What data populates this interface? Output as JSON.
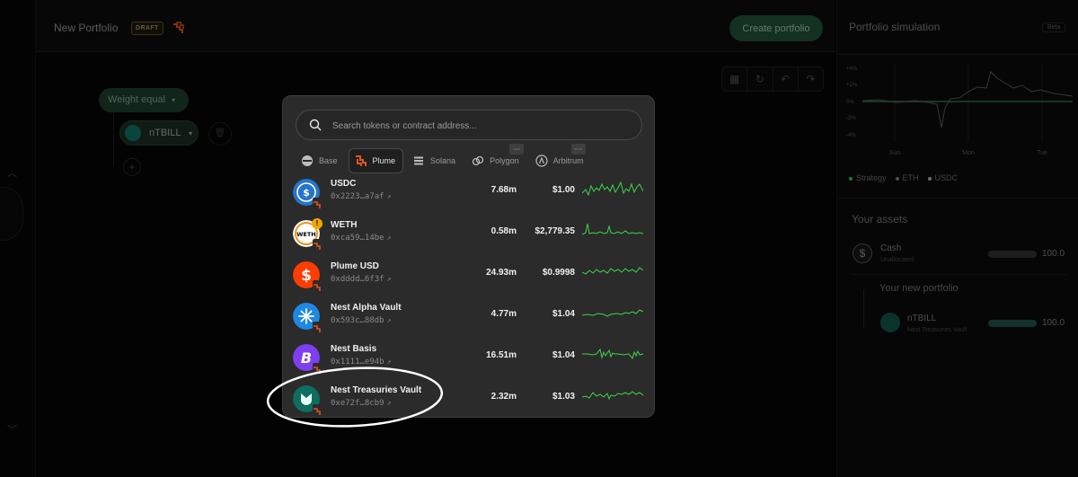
{
  "header": {
    "title": "New Portfolio",
    "draft_badge": "DRAFT",
    "create_label": "Create portfolio"
  },
  "canvas": {
    "weight_label": "Weight equal",
    "node_token": "nTBILL"
  },
  "simulation": {
    "title": "Portfolio simulation",
    "beta": "Beta",
    "y_ticks": [
      "+4%",
      "+2%",
      "0%",
      "-2%",
      "-4%"
    ],
    "x_ticks": [
      "Sun",
      "Mon",
      "Tue"
    ],
    "legend": [
      {
        "label": "Strategy",
        "color": "#3fb950"
      },
      {
        "label": "ETH",
        "color": "#777777"
      },
      {
        "label": "USDC",
        "color": "#aaaaaa"
      }
    ]
  },
  "assets": {
    "title": "Your assets",
    "cash_name": "Cash",
    "cash_sub": "Unallocated",
    "cash_pct": "100.0",
    "new_portfolio": "Your new portfolio",
    "token_name": "nTBILL",
    "token_sub": "Nest Treasuries Vault",
    "token_pct": "100.0"
  },
  "modal": {
    "search_placeholder": "Search tokens or contract address...",
    "chains": [
      {
        "label": "Base",
        "active": false
      },
      {
        "label": "Plume",
        "active": true
      },
      {
        "label": "Solana",
        "active": false
      },
      {
        "label": "Polygon",
        "active": false
      },
      {
        "label": "Arbitrum",
        "active": false
      }
    ],
    "badges": [
      "soon",
      "soon"
    ],
    "tokens": [
      {
        "name": "USDC",
        "address": "0x2223…a7af",
        "volume": "7.68m",
        "price": "$1.00",
        "icon_color": "#2775ca"
      },
      {
        "name": "WETH",
        "address": "0xca59…14be",
        "volume": "0.58m",
        "price": "$2,779.35",
        "icon_color": "#ffffff"
      },
      {
        "name": "Plume USD",
        "address": "0xdddd…6f3f",
        "volume": "24.93m",
        "price": "$0.9998",
        "icon_color": "#ff3d00"
      },
      {
        "name": "Nest Alpha Vault",
        "address": "0x593c…88db",
        "volume": "4.77m",
        "price": "$1.04",
        "icon_color": "#1e88e5"
      },
      {
        "name": "Nest Basis",
        "address": "0x1111…e94b",
        "volume": "16.51m",
        "price": "$1.04",
        "icon_color": "#7e3ff2"
      },
      {
        "name": "Nest Treasuries Vault",
        "address": "0xe72f…8cb9",
        "volume": "2.32m",
        "price": "$1.03",
        "icon_color": "#0e6d5e"
      }
    ]
  }
}
